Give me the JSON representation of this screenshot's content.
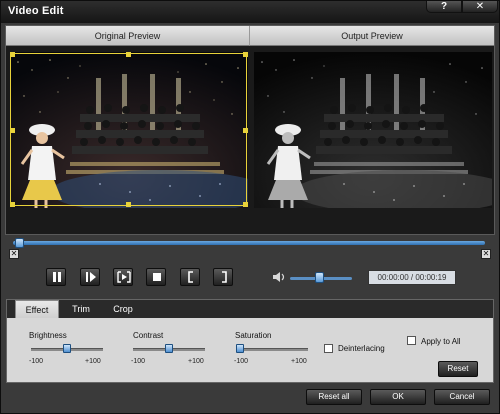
{
  "window": {
    "title": "Video Edit",
    "help_glyph": "?",
    "close_glyph": "✕"
  },
  "preview": {
    "original_label": "Original Preview",
    "output_label": "Output Preview"
  },
  "playback": {
    "time": "00:00:00 / 00:00:19",
    "seek_fraction": 0.0,
    "volume_fraction": 0.45
  },
  "tabs": [
    {
      "label": "Effect",
      "active": true
    },
    {
      "label": "Trim",
      "active": false
    },
    {
      "label": "Crop",
      "active": false
    }
  ],
  "effect": {
    "brightness": {
      "label": "Brightness",
      "min": "-100",
      "max": "+100",
      "value": 0
    },
    "contrast": {
      "label": "Contrast",
      "min": "-100",
      "max": "+100",
      "value": 0
    },
    "saturation": {
      "label": "Saturation",
      "min": "-100",
      "max": "+100",
      "value": -100
    },
    "deinterlacing": {
      "label": "Deinterlacing",
      "checked": false
    },
    "apply_to_all": {
      "label": "Apply to All",
      "checked": false
    },
    "reset_label": "Reset"
  },
  "buttons": {
    "reset_all": "Reset all",
    "ok": "OK",
    "cancel": "Cancel"
  },
  "colors": {
    "seek_blue": "#3f83c6",
    "crop_yellow": "#e8d23a",
    "window_dark": "#3a3a3a"
  }
}
